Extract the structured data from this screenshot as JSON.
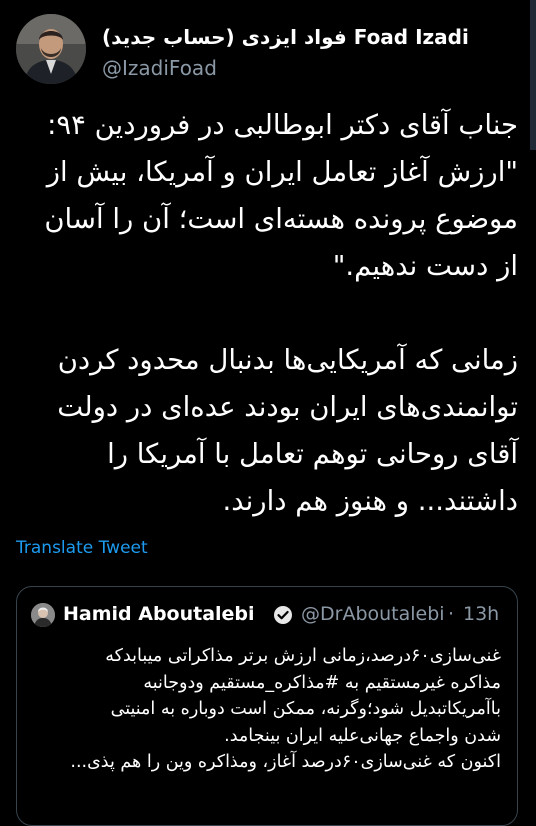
{
  "author": {
    "display_name": "(حساب جدید) فواد ایزدی Foad Izadi",
    "handle": "@IzadiFoad"
  },
  "tweet": {
    "paragraph1_lines": [
      "جناب آقای دکتر ابوطالبی در فروردین ۹۴:",
      "\"ارزش آغاز تعامل ایران و آمریکا، بیش از",
      "موضوع پرونده هسته‌ای است؛ آن را آسان",
      "از دست ندهیم.\""
    ],
    "paragraph2_lines": [
      "زمانی که آمریکایی‌ها بدنبال محدود کردن",
      "توانمندی‌های ایران بودند عده‌ای در دولت",
      "آقای روحانی توهم تعامل با آمریکا را",
      "داشتند... و هنوز هم دارند."
    ]
  },
  "translate_label": "Translate Tweet",
  "quote": {
    "name": "Hamid Aboutalebi",
    "handle": "@DrAboutalebi",
    "separator": "·",
    "time": "13h",
    "lines": [
      "غنی‌سازی۶۰درصد،زمانی ارزش برتر مذاکراتی میبابدکه",
      "مذاکره غیرمستقیم به #مذاکره_مستقیم ودوجانبه",
      "باآمریکاتبدیل شود؛وگرنه، ممکن است دوباره به امنیتی",
      "شدن واجماع جهانی‌علیه ایران بینجامد.",
      "اکنون که غنی‌سازی۶۰درصد آغاز، ومذاکره وین را هم پذی..."
    ]
  },
  "colors": {
    "background": "#000000",
    "link": "#1d9bf0",
    "secondary": "#8b98a5",
    "verified": "#1d9bf0"
  }
}
